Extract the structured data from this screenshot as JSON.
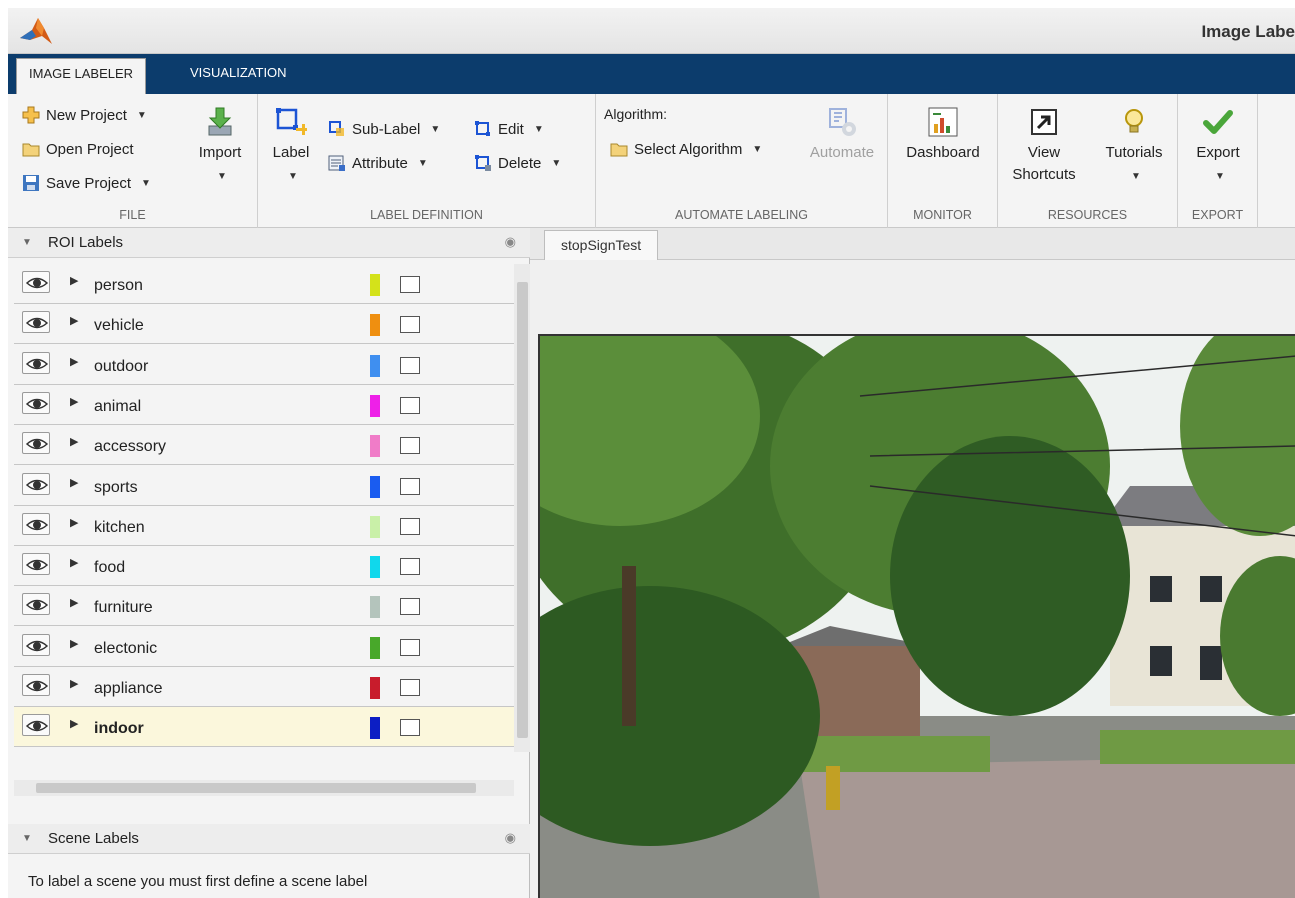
{
  "window": {
    "title": "Image Labe"
  },
  "tabs": {
    "labeler": "IMAGE LABELER",
    "visualization": "VISUALIZATION"
  },
  "ribbon": {
    "file": {
      "new_project": "New Project",
      "open_project": "Open Project",
      "save_project": "Save Project",
      "import": "Import",
      "group_label": "FILE"
    },
    "label_def": {
      "label": "Label",
      "sub_label": "Sub-Label",
      "attribute": "Attribute",
      "edit": "Edit",
      "delete": "Delete",
      "group_label": "LABEL DEFINITION"
    },
    "automate": {
      "algorithm_caption": "Algorithm:",
      "select_algorithm": "Select Algorithm",
      "automate": "Automate",
      "group_label": "AUTOMATE LABELING"
    },
    "monitor": {
      "dashboard": "Dashboard",
      "group_label": "MONITOR"
    },
    "resources": {
      "view": "View",
      "shortcuts": "Shortcuts",
      "tutorials": "Tutorials",
      "group_label": "RESOURCES"
    },
    "export": {
      "export": "Export",
      "group_label": "EXPORT"
    }
  },
  "roi_panel": {
    "title": "ROI Labels",
    "labels": [
      {
        "name": "person",
        "color": "#d4e21a"
      },
      {
        "name": "vehicle",
        "color": "#ef8f10"
      },
      {
        "name": "outdoor",
        "color": "#3f8ff0"
      },
      {
        "name": "animal",
        "color": "#ee20e8"
      },
      {
        "name": "accessory",
        "color": "#f07cc8"
      },
      {
        "name": "sports",
        "color": "#1a5cf0"
      },
      {
        "name": "kitchen",
        "color": "#c9f0a8"
      },
      {
        "name": "food",
        "color": "#10d8ec"
      },
      {
        "name": "furniture",
        "color": "#b4c4bc"
      },
      {
        "name": "electonic",
        "color": "#48a82a"
      },
      {
        "name": "appliance",
        "color": "#c81c2c"
      },
      {
        "name": "indoor",
        "color": "#0c1ec4"
      }
    ]
  },
  "scene_panel": {
    "title": "Scene Labels",
    "message": "To label a scene you must first define a scene label"
  },
  "document": {
    "tab": "stopSignTest"
  }
}
